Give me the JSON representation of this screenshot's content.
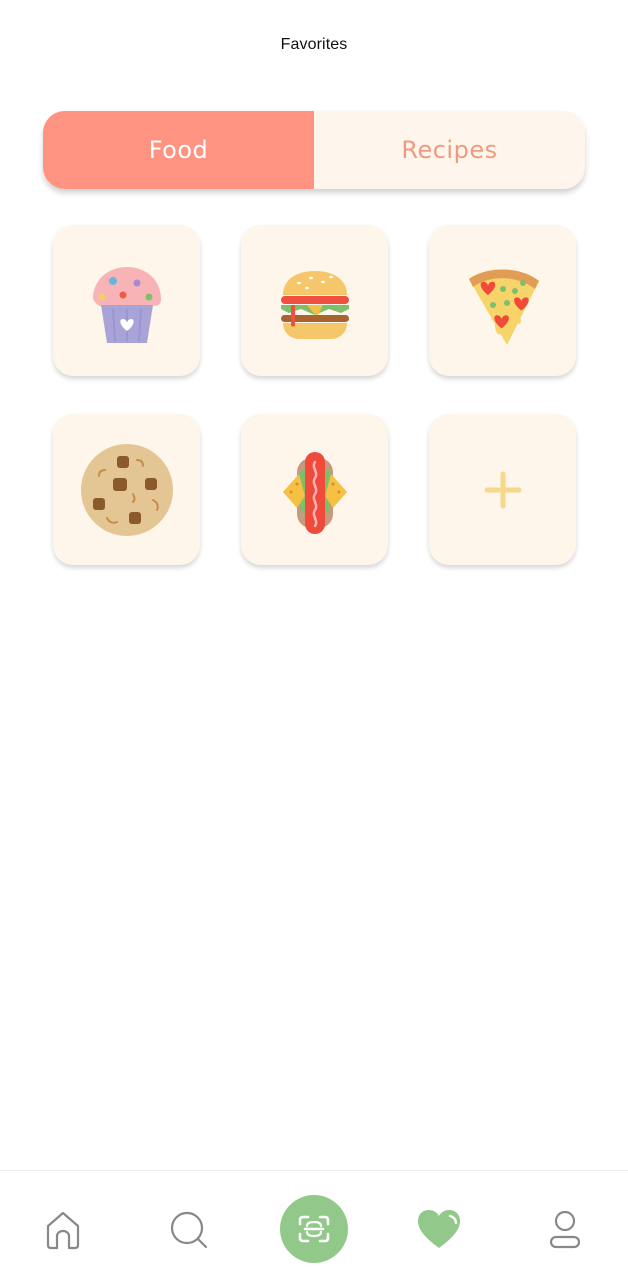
{
  "header": {
    "title": "Favorites"
  },
  "tabs": [
    {
      "label": "Food",
      "active": true
    },
    {
      "label": "Recipes",
      "active": false
    }
  ],
  "favorites": [
    {
      "icon": "cupcake-icon"
    },
    {
      "icon": "burger-icon"
    },
    {
      "icon": "pizza-slice-icon"
    },
    {
      "icon": "cookie-icon"
    },
    {
      "icon": "hotdog-icon"
    },
    {
      "icon": "plus-icon",
      "action": "add"
    }
  ],
  "bottom_nav": [
    {
      "icon": "home-icon"
    },
    {
      "icon": "search-icon"
    },
    {
      "icon": "scan-icon"
    },
    {
      "icon": "heart-icon",
      "active": true
    },
    {
      "icon": "profile-icon"
    }
  ],
  "colors": {
    "accent": "#ff9381",
    "tab_inactive_text": "#f09a80",
    "tile_bg": "#fef6ea",
    "nav_active": "#92c98b"
  }
}
